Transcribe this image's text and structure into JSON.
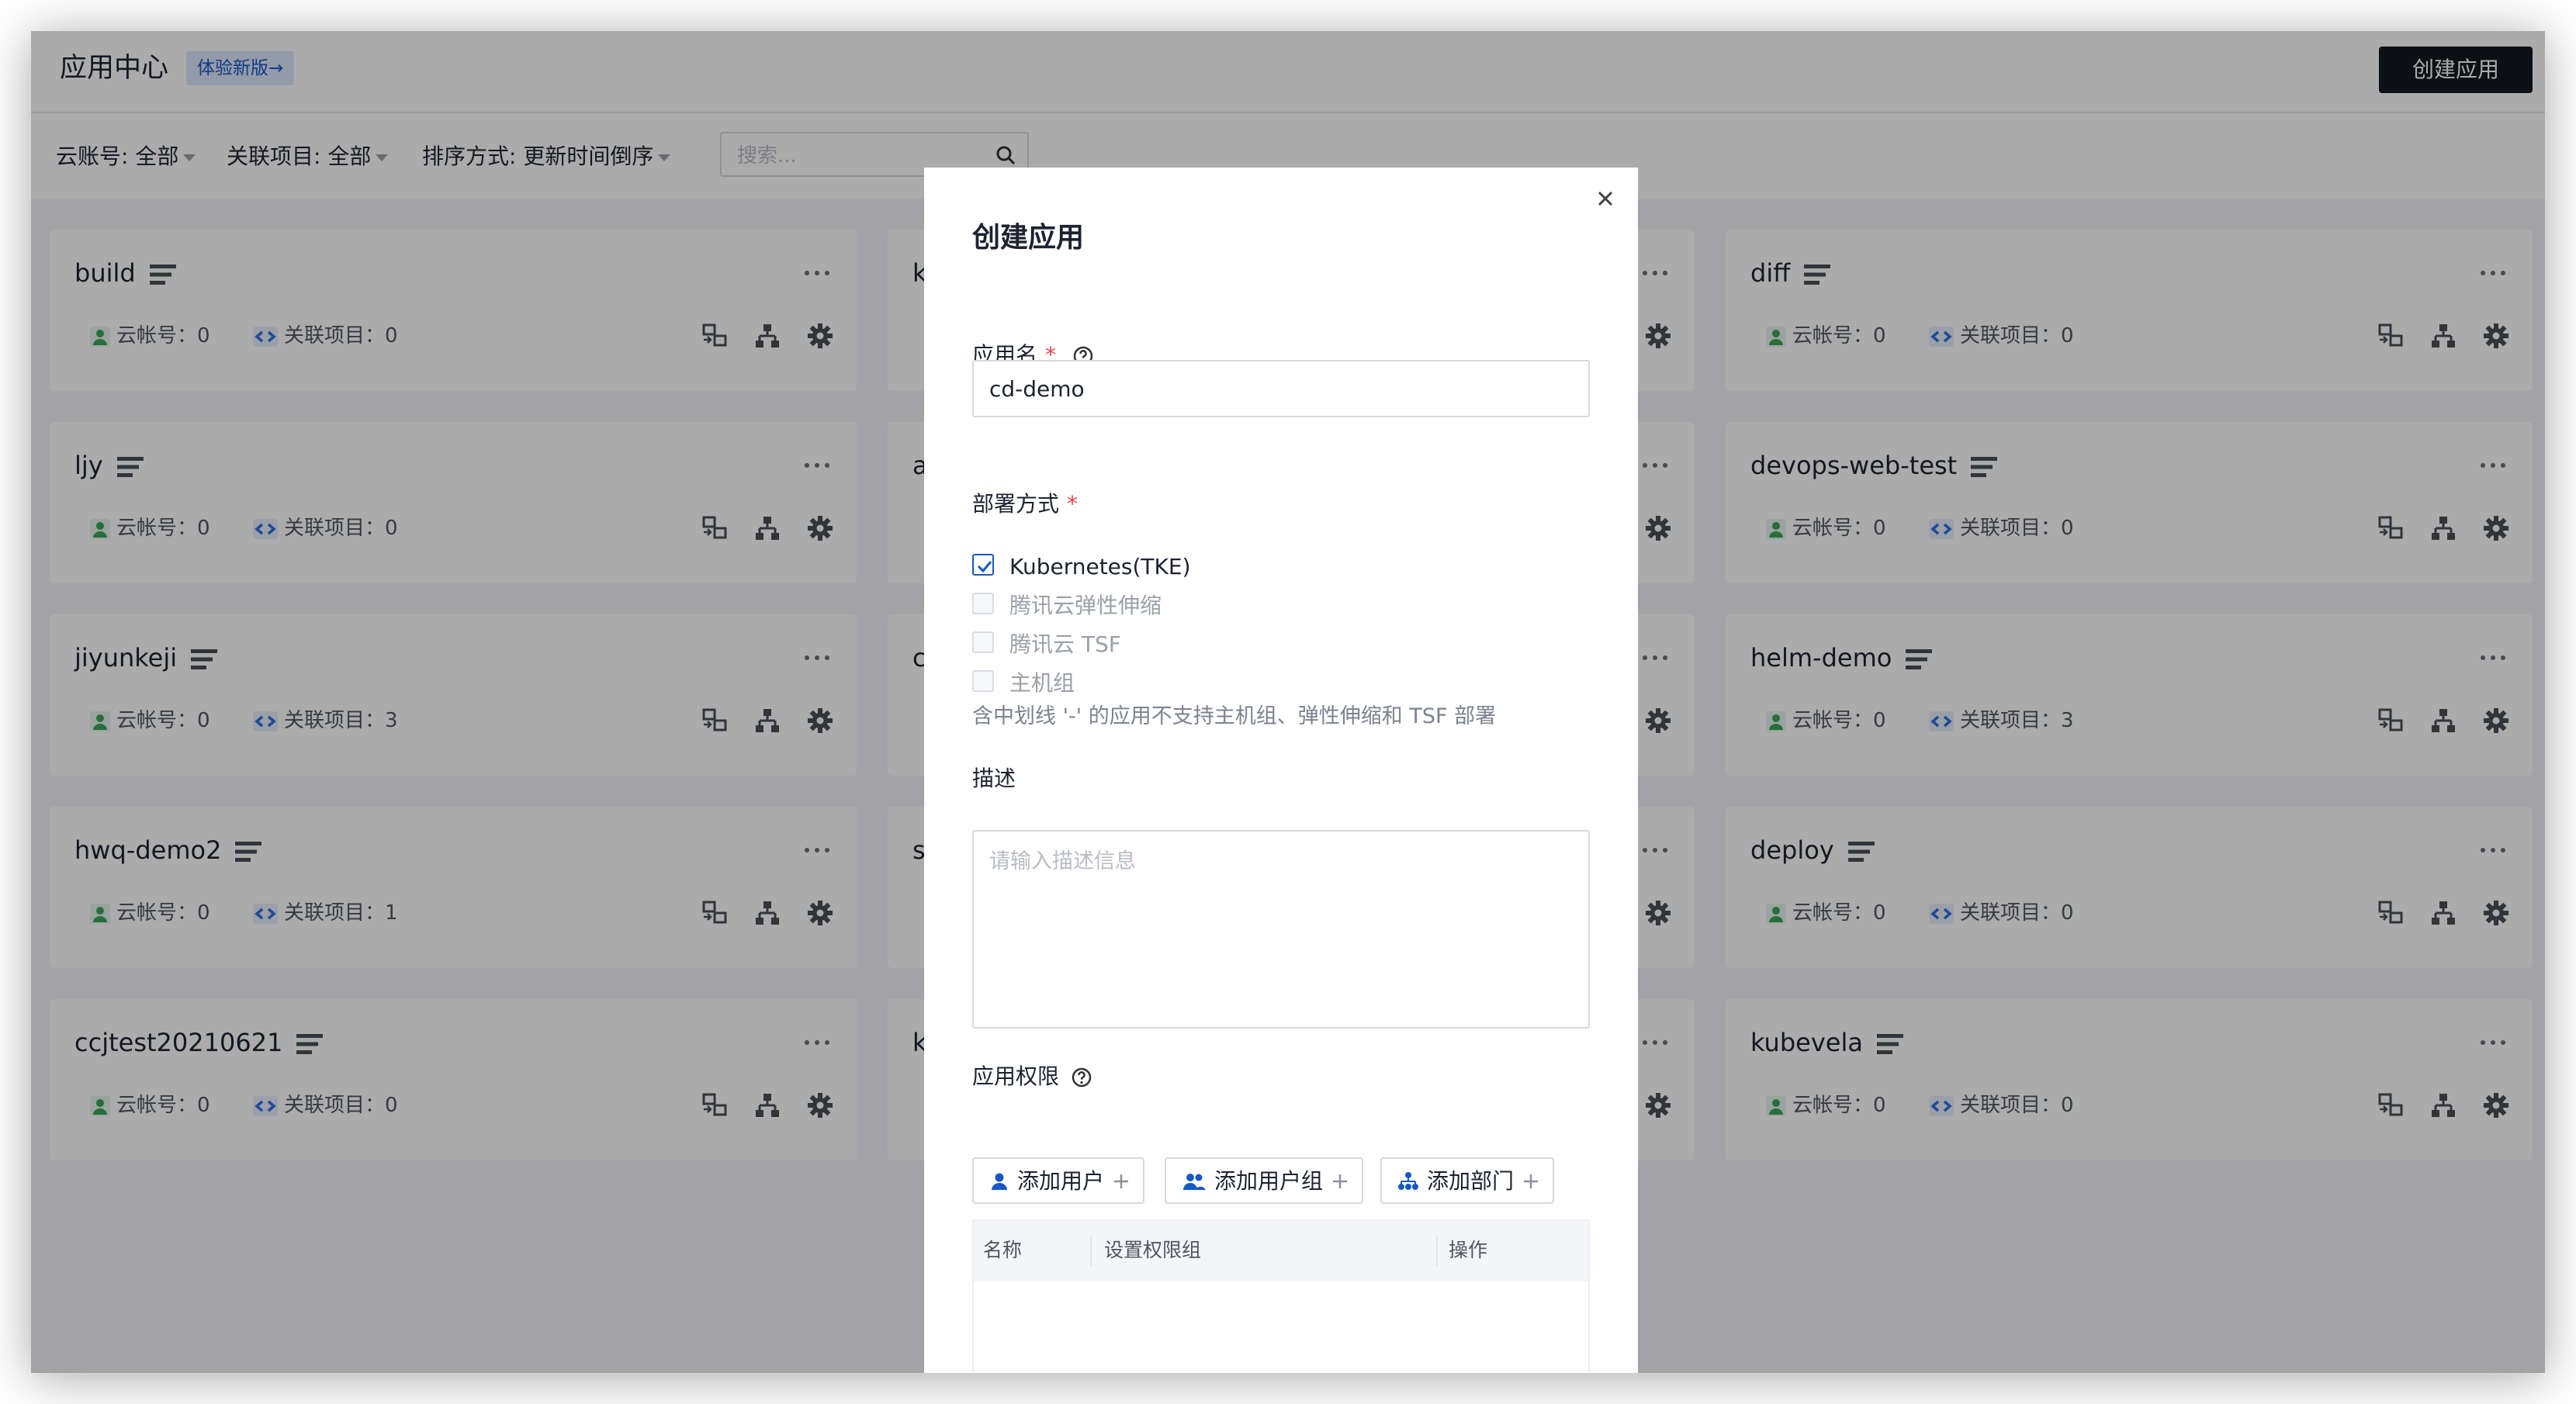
{
  "header": {
    "title": "应用中心",
    "badge": "体验新版→",
    "create_button": "创建应用"
  },
  "filters": {
    "account": "云账号:  全部",
    "project": "关联项目:  全部",
    "sort": "排序方式:  更新时间倒序",
    "search_placeholder": "搜索..."
  },
  "cards": [
    {
      "name": "build",
      "account": "云帐号：0",
      "project": "关联项目：0"
    },
    {
      "name": "k",
      "account": "",
      "project": ""
    },
    {
      "name": "diff",
      "account": "云帐号：0",
      "project": "关联项目：0"
    },
    {
      "name": "ljy",
      "account": "云帐号：0",
      "project": "关联项目：0"
    },
    {
      "name": "a",
      "account": "",
      "project": ""
    },
    {
      "name": "devops-web-test",
      "account": "云帐号：0",
      "project": "关联项目：0"
    },
    {
      "name": "jiyunkeji",
      "account": "云帐号：0",
      "project": "关联项目：3"
    },
    {
      "name": "c",
      "account": "",
      "project": ""
    },
    {
      "name": "helm-demo",
      "account": "云帐号：0",
      "project": "关联项目：3"
    },
    {
      "name": "hwq-demo2",
      "account": "云帐号：0",
      "project": "关联项目：1"
    },
    {
      "name": "s",
      "account": "",
      "project": ""
    },
    {
      "name": "deploy",
      "account": "云帐号：0",
      "project": "关联项目：0"
    },
    {
      "name": "ccjtest20210621",
      "account": "云帐号：0",
      "project": "关联项目：0"
    },
    {
      "name": "k",
      "account": "",
      "project": ""
    },
    {
      "name": "kubevela",
      "account": "云帐号：0",
      "project": "关联项目：0"
    }
  ],
  "modal": {
    "title": "创建应用",
    "app_name_label": "应用名",
    "app_name_value": "cd-demo",
    "deploy_label": "部署方式",
    "deploy_options": [
      {
        "label": "Kubernetes(TKE)",
        "checked": true
      },
      {
        "label": "腾讯云弹性伸缩",
        "checked": false
      },
      {
        "label": "腾讯云 TSF",
        "checked": false
      },
      {
        "label": "主机组",
        "checked": false
      }
    ],
    "deploy_hint": "含中划线 '-' 的应用不支持主机组、弹性伸缩和 TSF 部署",
    "desc_label": "描述",
    "desc_placeholder": "请输入描述信息",
    "perm_label": "应用权限",
    "add_user": "添加用户",
    "add_group": "添加用户组",
    "add_dept": "添加部门",
    "table_headers": [
      "名称",
      "设置权限组",
      "操作"
    ]
  },
  "colors": {
    "accent": "#1658c6",
    "dark_button": "#13181f",
    "required": "#e54545",
    "user_icon": "#3aa65a",
    "link_icon": "#2f6fe0"
  }
}
